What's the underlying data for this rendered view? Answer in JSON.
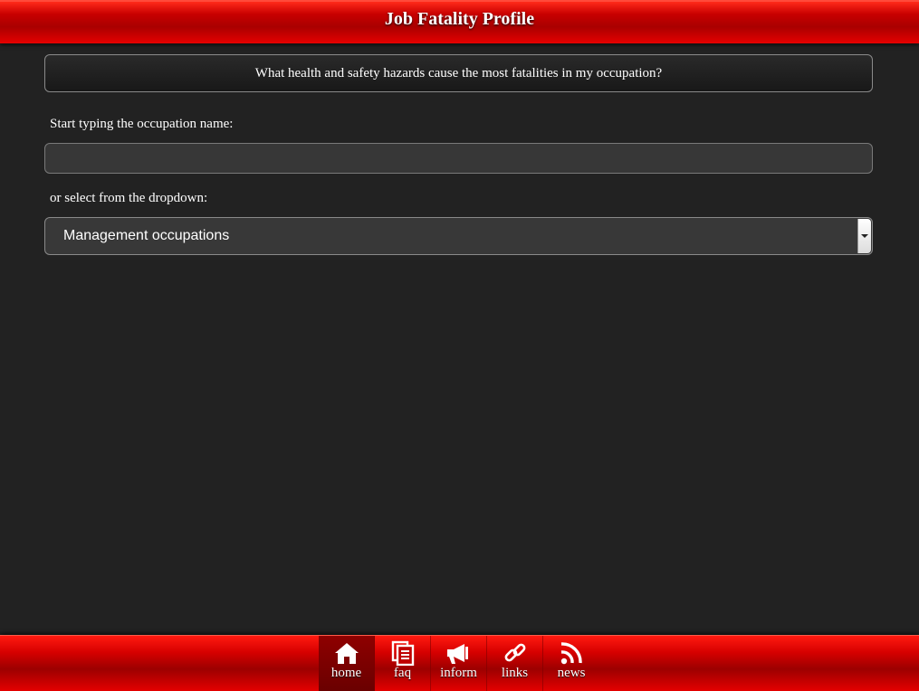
{
  "header": {
    "title": "Job Fatality Profile"
  },
  "question": {
    "text": "What health and safety hazards cause the most fatalities in my occupation?"
  },
  "search": {
    "label": "Start typing the occupation name:",
    "value": "",
    "placeholder": ""
  },
  "dropdown": {
    "label": "or select from the dropdown:",
    "selected": "Management occupations"
  },
  "nav": {
    "items": [
      {
        "label": "home",
        "icon": "home-icon",
        "active": true
      },
      {
        "label": "faq",
        "icon": "faq-icon",
        "active": false
      },
      {
        "label": "inform",
        "icon": "megaphone-icon",
        "active": false
      },
      {
        "label": "links",
        "icon": "link-icon",
        "active": false
      },
      {
        "label": "news",
        "icon": "rss-icon",
        "active": false
      }
    ]
  },
  "colors": {
    "background": "#222222",
    "header_red": "#c80000",
    "active_nav": "#7a0000"
  }
}
